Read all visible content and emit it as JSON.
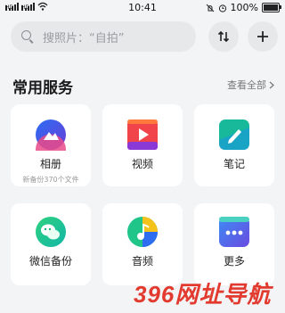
{
  "status_bar": {
    "time": "10:41",
    "battery": "100%",
    "signal_label": "HD"
  },
  "search": {
    "placeholder": "搜照片：“自拍”"
  },
  "section": {
    "title": "常用服务",
    "view_all": "查看全部"
  },
  "services": [
    {
      "label": "相册",
      "sub": "新备份370个文件",
      "icon": "album-icon"
    },
    {
      "label": "视频",
      "sub": "",
      "icon": "video-icon"
    },
    {
      "label": "笔记",
      "sub": "",
      "icon": "notes-icon"
    },
    {
      "label": "微信备份",
      "sub": "",
      "icon": "wechat-backup-icon"
    },
    {
      "label": "音频",
      "sub": "",
      "icon": "audio-icon"
    },
    {
      "label": "更多",
      "sub": "",
      "icon": "more-icon"
    }
  ],
  "watermark": "396网址导航",
  "colors": {
    "background": "#f3f4f6",
    "card": "#ffffff",
    "search_bg": "#e7e8ea",
    "watermark": "#e23a2e"
  }
}
